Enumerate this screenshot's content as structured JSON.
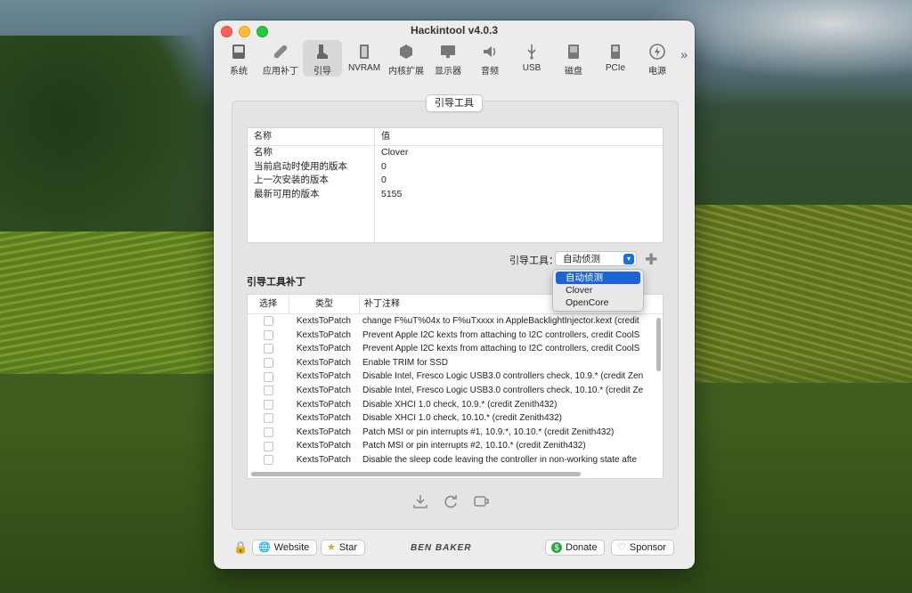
{
  "window": {
    "title": "Hackintool v4.0.3"
  },
  "toolbar": {
    "items": [
      {
        "label": "系统",
        "icon": "system-icon"
      },
      {
        "label": "应用补丁",
        "icon": "patch-icon"
      },
      {
        "label": "引导",
        "icon": "boot-icon",
        "active": true
      },
      {
        "label": "NVRAM",
        "icon": "nvram-icon"
      },
      {
        "label": "内核扩展",
        "icon": "kext-icon"
      },
      {
        "label": "显示器",
        "icon": "display-icon"
      },
      {
        "label": "音频",
        "icon": "audio-icon"
      },
      {
        "label": "USB",
        "icon": "usb-icon"
      },
      {
        "label": "磁盘",
        "icon": "disk-icon"
      },
      {
        "label": "PCIe",
        "icon": "pcie-icon"
      },
      {
        "label": "电源",
        "icon": "power-icon"
      }
    ],
    "more": "»"
  },
  "panel": {
    "tab_label": "引导工具",
    "info_table": {
      "headers": [
        "名称",
        "值"
      ],
      "rows": [
        [
          "名称",
          "Clover"
        ],
        [
          "当前启动时使用的版本",
          "0"
        ],
        [
          "上一次安装的版本",
          "0"
        ],
        [
          "最新可用的版本",
          "5155"
        ]
      ]
    },
    "bootloader_label": "引导工具：",
    "bootloader_value": "自动侦测",
    "dropdown_options": [
      "自动侦测",
      "Clover",
      "OpenCore"
    ],
    "patches_title": "引导工具补丁",
    "patch_table": {
      "headers": [
        "选择",
        "类型",
        "补丁注释"
      ],
      "rows": [
        [
          "KextsToPatch",
          "change F%uT%04x to F%uTxxxx in AppleBacklightInjector.kext (credit"
        ],
        [
          "KextsToPatch",
          "Prevent Apple I2C kexts from attaching to I2C controllers, credit CoolS"
        ],
        [
          "KextsToPatch",
          "Prevent Apple I2C kexts from attaching to I2C controllers, credit CoolS"
        ],
        [
          "KextsToPatch",
          "Enable TRIM for SSD"
        ],
        [
          "KextsToPatch",
          "Disable Intel, Fresco Logic USB3.0 controllers check, 10.9.* (credit Zen"
        ],
        [
          "KextsToPatch",
          "Disable Intel, Fresco Logic USB3.0 controllers check, 10.10.* (credit Ze"
        ],
        [
          "KextsToPatch",
          "Disable XHCI 1.0 check, 10.9.* (credit Zenith432)"
        ],
        [
          "KextsToPatch",
          "Disable XHCI 1.0 check, 10.10.* (credit Zenith432)"
        ],
        [
          "KextsToPatch",
          "Patch MSI or pin interrupts #1, 10.9.*, 10.10.* (credit Zenith432)"
        ],
        [
          "KextsToPatch",
          "Patch MSI or pin interrupts #2, 10.10.* (credit Zenith432)"
        ],
        [
          "KextsToPatch",
          "Disable the sleep code leaving the controller in non-working state afte"
        ]
      ]
    }
  },
  "footer": {
    "website": "Website",
    "star": "Star",
    "brand": "BEN BAKER",
    "donate": "Donate",
    "sponsor": "Sponsor"
  }
}
